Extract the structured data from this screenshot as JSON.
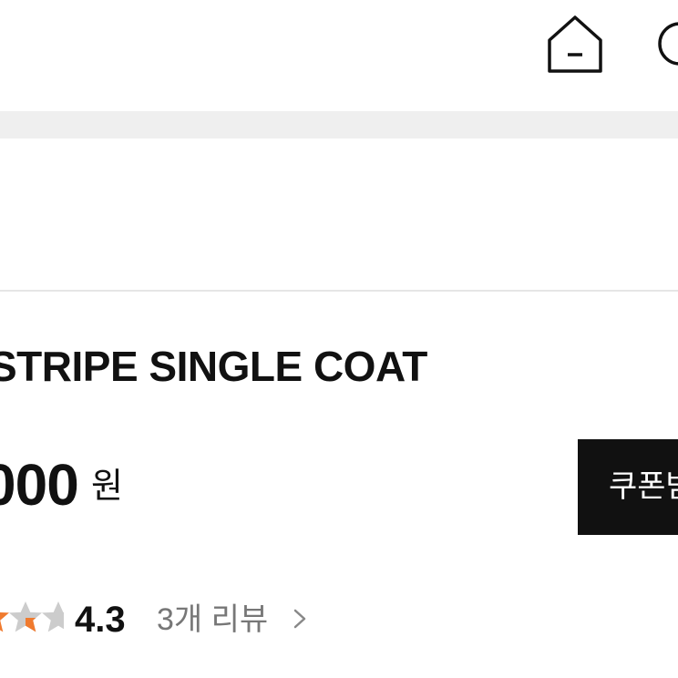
{
  "header": {
    "icons": [
      "home-icon",
      "search-icon"
    ]
  },
  "product": {
    "title": "STRIPE SINGLE COAT",
    "price": "000",
    "price_unit": "원",
    "coupon_button_label": "쿠폰받"
  },
  "rating": {
    "score": "4.3",
    "review_link_label": "3개 리뷰",
    "stars_filled": 4.3,
    "stars_max": 5,
    "star_color": "#f07a2e",
    "star_empty_color": "#cccccc"
  }
}
